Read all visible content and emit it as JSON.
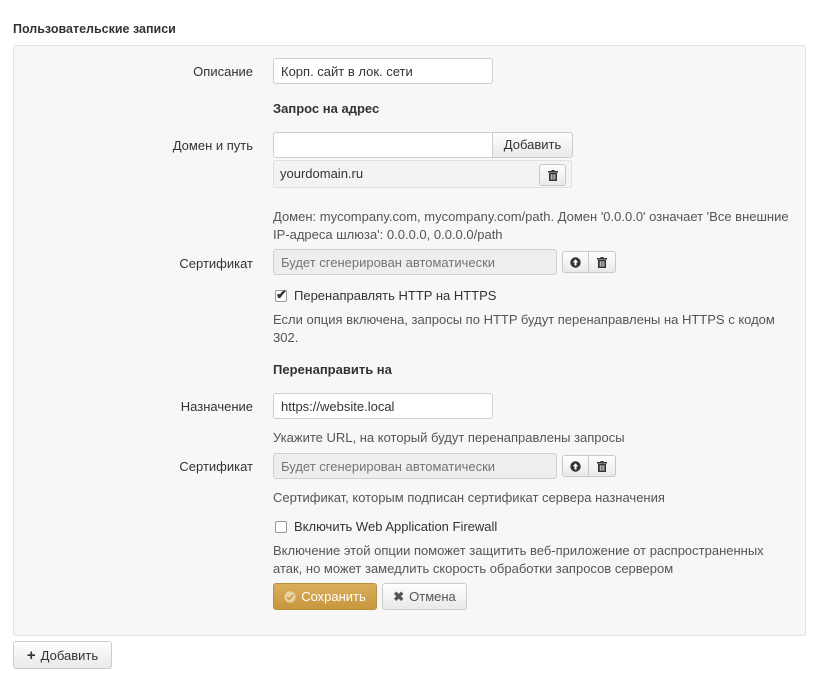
{
  "section_title": "Пользовательские записи",
  "description": {
    "label": "Описание",
    "value": "Корп. сайт в лок. сети"
  },
  "request_heading": "Запрос на адрес",
  "domain": {
    "label": "Домен и путь",
    "value": "",
    "add_label": "Добавить",
    "entries": [
      "yourdomain.ru"
    ],
    "help": "Домен: mycompany.com, mycompany.com/path. Домен '0.0.0.0' означает 'Все внешние IP-адреса шлюза': 0.0.0.0, 0.0.0.0/path"
  },
  "certificate1": {
    "label": "Сертификат",
    "placeholder": "Будет сгенерирован автоматически"
  },
  "redirect_https": {
    "label": "Перенаправлять HTTP на HTTPS",
    "checked": true,
    "help": "Если опция включена, запросы по HTTP будут перенаправлены на HTTPS с кодом 302."
  },
  "redirect_heading": "Перенаправить на",
  "destination": {
    "label": "Назначение",
    "value": "https://website.local",
    "help": "Укажите URL, на который будут перенаправлены запросы"
  },
  "certificate2": {
    "label": "Сертификат",
    "placeholder": "Будет сгенерирован автоматически",
    "help": "Сертификат, которым подписан сертификат сервера назначения"
  },
  "waf": {
    "label": "Включить Web Application Firewall",
    "checked": false,
    "help": "Включение этой опции поможет защитить веб-приложение от распространенных атак, но может замедлить скорость обработки запросов сервером"
  },
  "actions": {
    "save_label": "Сохранить",
    "cancel_label": "Отмена"
  },
  "add_record_label": "Добавить",
  "colors": {
    "save_button": "#cfa24c",
    "panel_bg": "#f7f7f7"
  },
  "icons": [
    "upload-icon",
    "trash-icon",
    "check-icon",
    "close-icon",
    "plus-icon"
  ]
}
